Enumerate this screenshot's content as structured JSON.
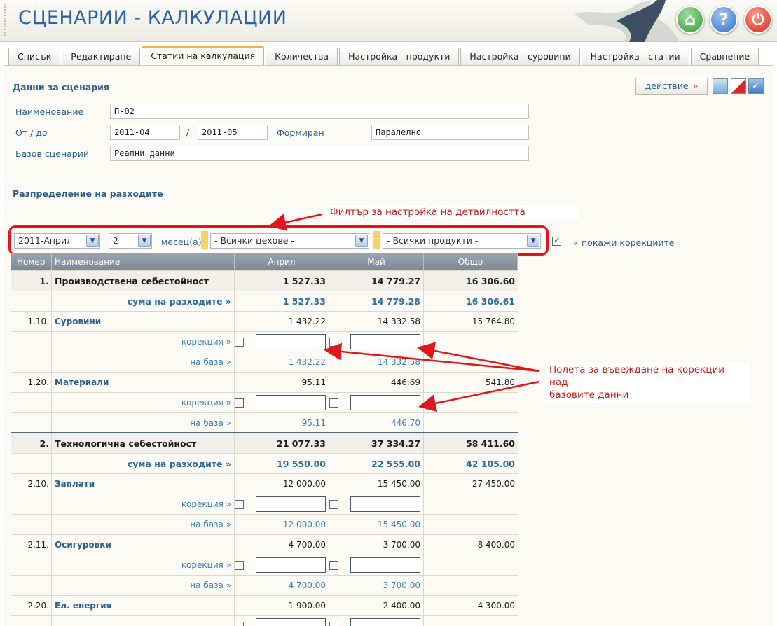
{
  "header": {
    "title": "СЦЕНАРИИ - КАЛКУЛАЦИИ",
    "buttons": [
      "home-icon",
      "help-icon",
      "power-icon"
    ]
  },
  "tabs": [
    {
      "label": "Списък",
      "active": false
    },
    {
      "label": "Редактиране",
      "active": false
    },
    {
      "label": "Статии на калкулация",
      "active": true
    },
    {
      "label": "Количества",
      "active": false
    },
    {
      "label": "Настройка - продукти",
      "active": false
    },
    {
      "label": "Настройка - суровини",
      "active": false
    },
    {
      "label": "Настройка - статии",
      "active": false
    },
    {
      "label": "Сравнение",
      "active": false
    }
  ],
  "scenario": {
    "title": "Данни за сценария",
    "action_label": "действие",
    "action_arrow": "»",
    "name_label": "Наименование",
    "name_value": "П-02",
    "period_label": "От / до",
    "from_value": "2011-04",
    "slash": "/",
    "to_value": "2011-05",
    "formed_label": "Формиран",
    "formed_value": "Паралелно",
    "base_label": "Базов сценарий",
    "base_value": "Реални данни"
  },
  "distribution": {
    "title": "Разпределение на разходите"
  },
  "filters": {
    "month_select": "2011-Април",
    "count_select": "2",
    "months_label": "месец(а)",
    "workshops_select": "- Всички цехове -",
    "products_select": "- Всички продукти -",
    "show_corrections_checked": true,
    "show_corrections_arrow": "«",
    "show_corrections_label": "покажи корекциите"
  },
  "annotations": {
    "filter_note": "Филтър за настройка на детайлността",
    "corrections_note_line1": "Полета за въвеждане на корекции над",
    "corrections_note_line2": "базовите данни"
  },
  "table": {
    "headers": [
      "Номер",
      "Наименование",
      "Април",
      "Май",
      "Общо"
    ],
    "rows": [
      {
        "type": "group",
        "num": "1.",
        "name": "Производствена себестойност",
        "apr": "1 527.33",
        "may": "14 779.27",
        "total": "16 306.60"
      },
      {
        "type": "sum",
        "num": "",
        "name": "сума на разходите »",
        "apr": "1 527.33",
        "may": "14 779.28",
        "total": "16 306.61"
      },
      {
        "type": "item",
        "num": "1.10.",
        "name": "Суровини",
        "apr": "1 432.22",
        "may": "14 332.58",
        "total": "15 764.80"
      },
      {
        "type": "corr",
        "num": "",
        "name": "корекция »",
        "apr": "",
        "may": "",
        "total": ""
      },
      {
        "type": "base",
        "num": "",
        "name": "на база »",
        "apr": "1 432.22",
        "may": "14 332.58",
        "total": ""
      },
      {
        "type": "item",
        "num": "1.20.",
        "name": "Материали",
        "apr": "95.11",
        "may": "446.69",
        "total": "541.80"
      },
      {
        "type": "corr",
        "num": "",
        "name": "корекция »",
        "apr": "",
        "may": "",
        "total": ""
      },
      {
        "type": "base",
        "num": "",
        "name": "на база »",
        "apr": "95.11",
        "may": "446.70",
        "total": ""
      },
      {
        "type": "group",
        "num": "2.",
        "name": "Технологична себестойност",
        "apr": "21 077.33",
        "may": "37 334.27",
        "total": "58 411.60"
      },
      {
        "type": "sum",
        "num": "",
        "name": "сума на разходите »",
        "apr": "19 550.00",
        "may": "22 555.00",
        "total": "42 105.00"
      },
      {
        "type": "item",
        "num": "2.10.",
        "name": "Заплати",
        "apr": "12 000.00",
        "may": "15 450.00",
        "total": "27 450.00"
      },
      {
        "type": "corr",
        "num": "",
        "name": "корекция »",
        "apr": "",
        "may": "",
        "total": ""
      },
      {
        "type": "base",
        "num": "",
        "name": "на база »",
        "apr": "12 000.00",
        "may": "15 450.00",
        "total": ""
      },
      {
        "type": "item",
        "num": "2.11.",
        "name": "Осигуровки",
        "apr": "4 700.00",
        "may": "3 700.00",
        "total": "8 400.00"
      },
      {
        "type": "corr",
        "num": "",
        "name": "корекция »",
        "apr": "",
        "may": "",
        "total": ""
      },
      {
        "type": "base",
        "num": "",
        "name": "на база »",
        "apr": "4 700.00",
        "may": "3 700.00",
        "total": ""
      },
      {
        "type": "item",
        "num": "2.20.",
        "name": "Ел. енергия",
        "apr": "1 900.00",
        "may": "2 400.00",
        "total": "4 300.00"
      },
      {
        "type": "corr",
        "num": "",
        "name": "",
        "apr": "",
        "may": "",
        "total": ""
      }
    ]
  },
  "colors": {
    "title": "#2761a6",
    "accent": "#2d5e86",
    "annotation": "#e3141b"
  }
}
